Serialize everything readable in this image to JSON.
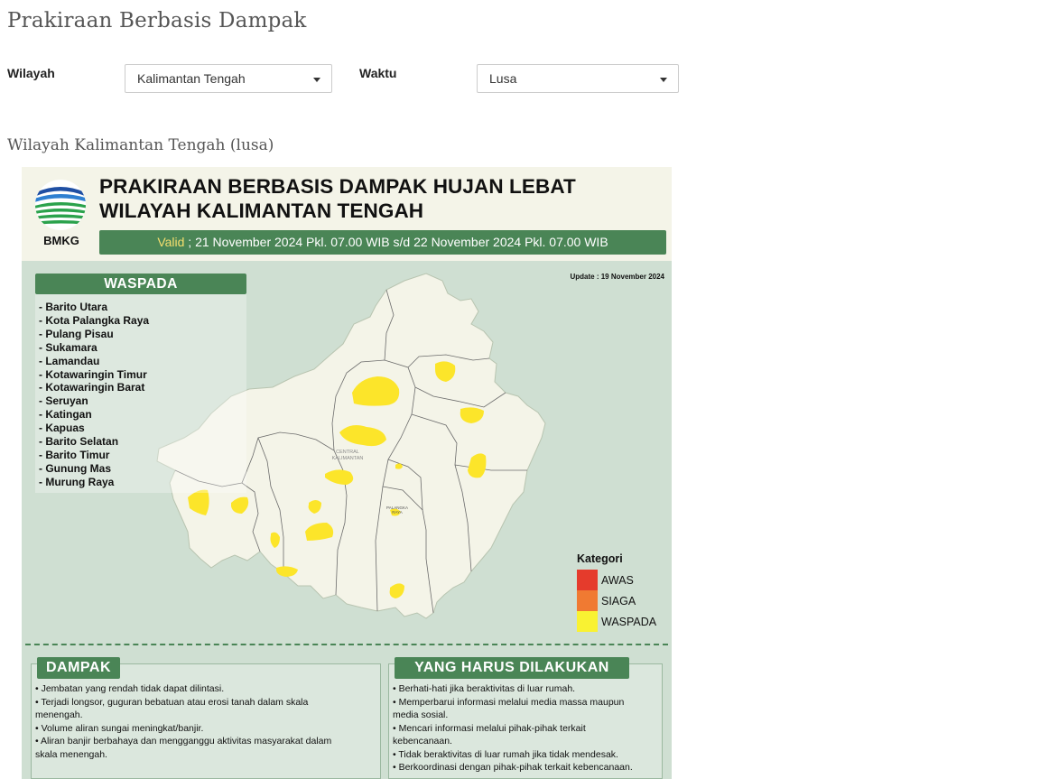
{
  "page": {
    "title": "Prakiraan Berbasis Dampak",
    "subtitle": "Wilayah Kalimantan Tengah (lusa)"
  },
  "filters": {
    "region_label": "Wilayah",
    "region_value": "Kalimantan Tengah",
    "time_label": "Waktu",
    "time_value": "Lusa"
  },
  "infographic": {
    "logo_text": "BMKG",
    "title_line1": "PRAKIRAAN BERBASIS DAMPAK HUJAN LEBAT",
    "title_line2": "WILAYAH KALIMANTAN TENGAH",
    "valid_word": "Valid",
    "valid_text": " ; 21 November 2024 Pkl. 07.00 WIB s/d 22 November 2024 Pkl. 07.00 WIB",
    "update_note": "Update : 19 November 2024",
    "waspada_heading": "WASPADA",
    "waspada_regions": [
      "- Barito Utara",
      "- Kota Palangka Raya",
      "- Pulang Pisau",
      "- Sukamara",
      "- Lamandau",
      "- Kotawaringin Timur",
      "- Kotawaringin Barat",
      "- Seruyan",
      "- Katingan",
      "- Kapuas",
      "- Barito Selatan",
      "- Barito Timur",
      "- Gunung Mas",
      "- Murung Raya"
    ],
    "map_labels": {
      "province_line1": "CENTRAL",
      "province_line2": "KALIMANTAN",
      "capital_line1": "PALANGKA",
      "capital_line2": "RAYA"
    },
    "legend": {
      "title": "Kategori",
      "items": [
        {
          "label": "AWAS",
          "color": "#e53b2c"
        },
        {
          "label": "SIAGA",
          "color": "#f07a32"
        },
        {
          "label": "WASPADA",
          "color": "#f9f232"
        }
      ]
    },
    "dampak": {
      "heading": "DAMPAK",
      "items": [
        "• Jembatan yang rendah tidak dapat dilintasi.",
        "• Terjadi longsor, guguran bebatuan atau erosi tanah dalam skala",
        "menengah.",
        "• Volume aliran sungai meningkat/banjir.",
        "• Aliran banjir berbahaya dan mengganggu aktivitas masyarakat dalam",
        "skala menengah."
      ]
    },
    "tindakan": {
      "heading": "YANG HARUS DILAKUKAN",
      "items": [
        "• Berhati-hati jika beraktivitas di luar rumah.",
        "• Memperbarui informasi melalui media massa maupun",
        "media sosial.",
        "• Mencari informasi melalui pihak-pihak terkait",
        "kebencanaan.",
        "• Tidak beraktivitas di luar rumah jika tidak mendesak.",
        "• Berkoordinasi dengan pihak-pihak terkait kebencanaan."
      ]
    },
    "colors": {
      "brand_green": "#4a8556",
      "map_land": "#f4f4e8",
      "map_background": "#cfdfd2",
      "waspada_yellow": "#fce52a"
    }
  }
}
